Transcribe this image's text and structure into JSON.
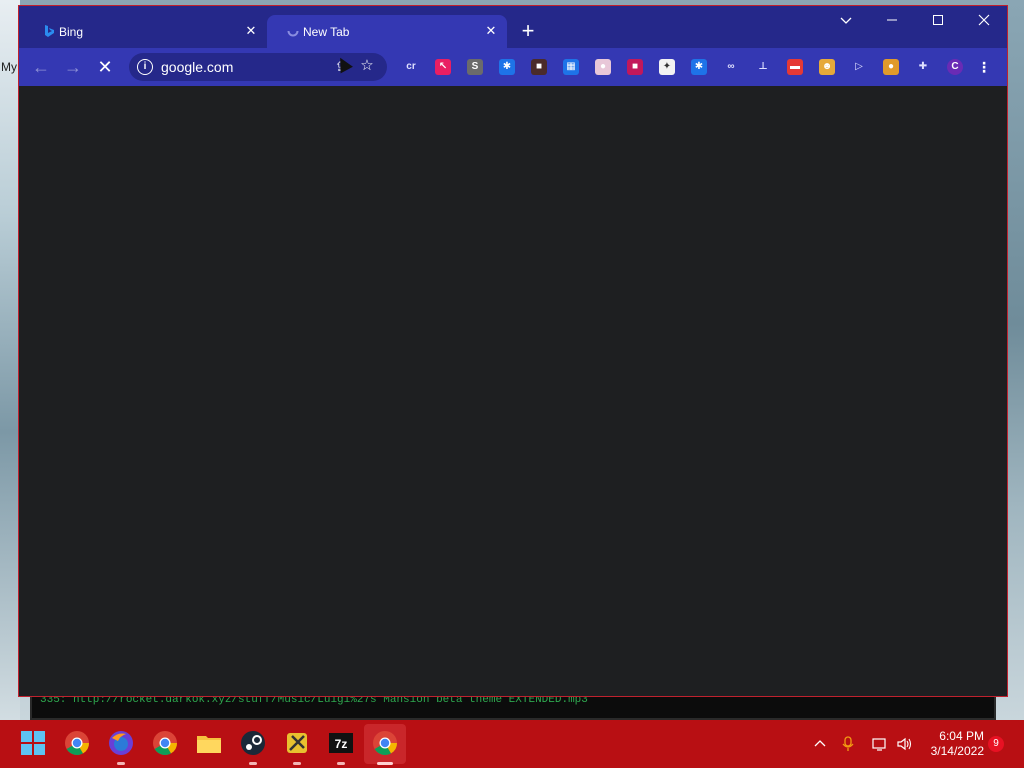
{
  "desktop": {
    "left_label": "My",
    "terminal_line": "335: http://rocket.darkok.xyz/stuff/Music/Luigi%27s Mansion beta theme EXTENDED.mp3"
  },
  "browser": {
    "tabs": [
      {
        "label": "Bing",
        "favicon": "bing-icon",
        "active": false
      },
      {
        "label": "New Tab",
        "favicon": "loading-icon",
        "active": true
      }
    ],
    "omnibox": {
      "url": "google.com"
    },
    "theme": {
      "frame": "#25288a",
      "toolbar": "#3438b3",
      "content": "#1e1f21"
    },
    "extensions": [
      {
        "name": "cr-extension-icon",
        "glyph": "cr",
        "color": "#3438b3"
      },
      {
        "name": "red-cursor-extension-icon",
        "glyph": "↖",
        "color": "#e91e63"
      },
      {
        "name": "s-extension-icon",
        "glyph": "S",
        "color": "#6b6b6b"
      },
      {
        "name": "blue-puzzle-extension-icon",
        "glyph": "✱",
        "color": "#1e73e8"
      },
      {
        "name": "dark-extension-icon",
        "glyph": "■",
        "color": "#4a2b2b"
      },
      {
        "name": "grid-extension-icon",
        "glyph": "▦",
        "color": "#1e73e8"
      },
      {
        "name": "stripes-extension-icon",
        "glyph": "●",
        "color": "#e8c7d8"
      },
      {
        "name": "red-square-extension-icon",
        "glyph": "■",
        "color": "#c2185b"
      },
      {
        "name": "white-extension-icon",
        "glyph": "✦",
        "color": "#f2f2f2"
      },
      {
        "name": "blue-piece-extension-icon",
        "glyph": "✱",
        "color": "#1e73e8"
      },
      {
        "name": "link-extension-icon",
        "glyph": "∞",
        "color": "#3438b3"
      },
      {
        "name": "tower-extension-icon",
        "glyph": "⊥",
        "color": "#3438b3"
      },
      {
        "name": "red-card-extension-icon",
        "glyph": "▬",
        "color": "#e53935"
      },
      {
        "name": "cat-extension-icon",
        "glyph": "☻",
        "color": "#e6a93a"
      },
      {
        "name": "play-extension-icon",
        "glyph": "▷",
        "color": "#3438b3"
      },
      {
        "name": "cookie-extension-icon",
        "glyph": "●",
        "color": "#e09a2b"
      },
      {
        "name": "extensions-puzzle-icon",
        "glyph": "✚",
        "color": "#3438b3"
      },
      {
        "name": "profile-avatar",
        "glyph": "C",
        "color": "#6a2bb5"
      }
    ]
  },
  "taskbar": {
    "time": "6:04 PM",
    "date": "3/14/2022",
    "notification_count": "9"
  }
}
